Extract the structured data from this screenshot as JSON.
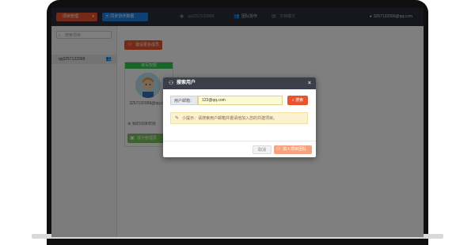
{
  "topbar": {
    "project_button": "项目管理",
    "sync_button": "同步协作数据",
    "tab_user": "qq3257132999",
    "tab_team": "团队协作",
    "tab_docs": "文档模式",
    "user_email": "3257132999@qq.com"
  },
  "sidebar": {
    "search_placeholder": "搜索项目",
    "item_label": "qq3257132999"
  },
  "main": {
    "invite_button": "邀请更多成员",
    "card_badge": "读写权限",
    "card_email": "3257132999@qq.com",
    "card_note": "我的项目权限",
    "card_action": "成为管理员"
  },
  "modal": {
    "title": "搜索用户",
    "close": "×",
    "field_label": "用户邮箱：",
    "field_value": "123@qq.com",
    "search_button": "搜索",
    "tip_text": "小提示：请搜索用户邮箱并邀请他加入您的共建项目。",
    "cancel_button": "取消",
    "join_button": "加入项目团队"
  },
  "colors": {
    "accent": "#e8542c",
    "topbar": "#2b2e38",
    "green": "#2ecb52",
    "blue": "#1e7fe0"
  }
}
